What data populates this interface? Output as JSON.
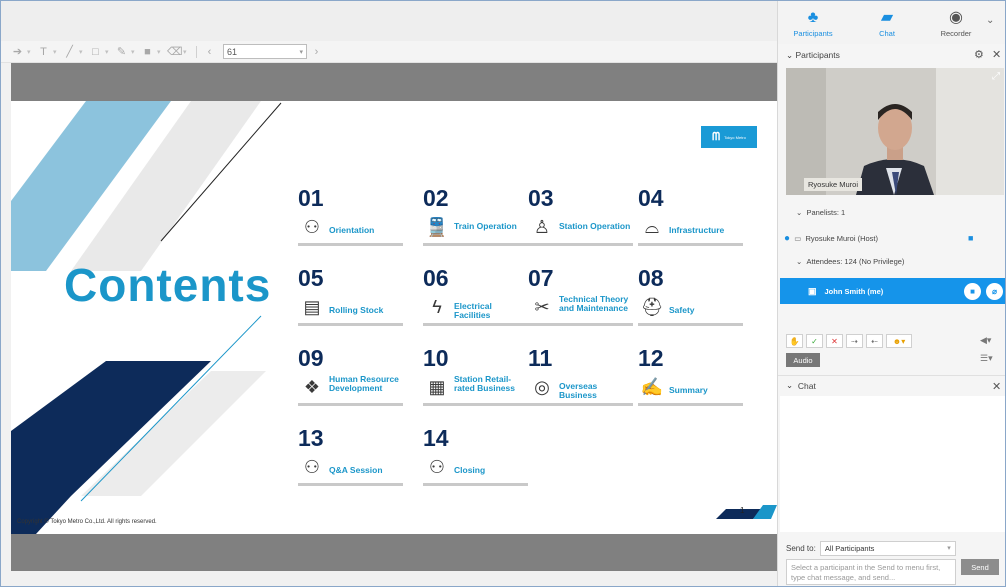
{
  "toolbar": {
    "zoom_value": "61"
  },
  "slide": {
    "title": "Contents",
    "copyright": "Copyright © Tokyo Metro Co.,Ltd. All rights reserved.",
    "page_number": "1",
    "logo_text": "Tokyo Metro",
    "items": [
      {
        "num": "01",
        "label": "Orientation",
        "icon": "people-icon"
      },
      {
        "num": "02",
        "label": "Train Operation",
        "icon": "train-icon"
      },
      {
        "num": "03",
        "label": "Station Operation",
        "icon": "station-staff-icon"
      },
      {
        "num": "04",
        "label": "Infrastructure",
        "icon": "tunnel-icon"
      },
      {
        "num": "05",
        "label": "Rolling Stock",
        "icon": "railcar-icon"
      },
      {
        "num": "06",
        "label": "Electrical Facilities",
        "icon": "lightning-icon"
      },
      {
        "num": "07",
        "label": "Technical Theory and Maintenance",
        "icon": "tools-icon"
      },
      {
        "num": "08",
        "label": "Safety",
        "icon": "helmet-icon"
      },
      {
        "num": "09",
        "label": "Human Resource Development",
        "icon": "hr-icon"
      },
      {
        "num": "10",
        "label": "Station Retail-rated Business",
        "icon": "shop-icon"
      },
      {
        "num": "11",
        "label": "Overseas Business",
        "icon": "globe-icon"
      },
      {
        "num": "12",
        "label": "Summary",
        "icon": "document-icon"
      },
      {
        "num": "13",
        "label": "Q&A Session",
        "icon": "people-icon"
      },
      {
        "num": "14",
        "label": "Closing",
        "icon": "people-icon"
      }
    ]
  },
  "right_panel": {
    "tabs": {
      "participants": "Participants",
      "chat": "Chat",
      "recorder": "Recorder"
    },
    "participants_title": "Participants",
    "video_name": "Ryosuke Muroi",
    "panelists": "Panelists: 1",
    "host": "Ryosuke Muroi (Host)",
    "attendees": "Attendees: 124 (No Privilege)",
    "me": "John Smith (me)",
    "audio_label": "Audio",
    "chat_title": "Chat",
    "send_to_label": "Send to:",
    "send_to_value": "All Participants",
    "chat_placeholder": "Select a participant in the Send to menu first, type chat message, and send...",
    "send_label": "Send"
  },
  "colors": {
    "accent": "#1594ea",
    "slide_blue": "#1b96c9",
    "navy": "#0d2b5a"
  }
}
